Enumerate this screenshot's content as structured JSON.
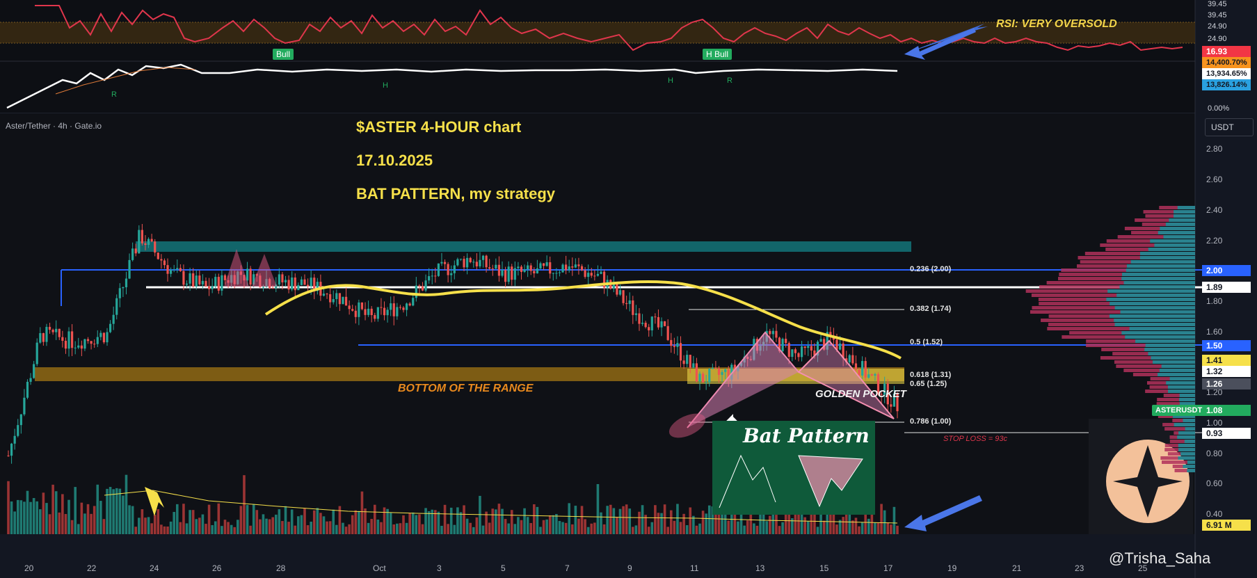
{
  "header": {
    "symbol": "Aster/Tether · 4h · Gate.io",
    "title_lines": [
      "$ASTER   4-HOUR chart",
      "17.10.2025",
      "BAT PATTERN, my strategy"
    ],
    "unit_button": "USDT"
  },
  "annotations": {
    "rsi_note": "RSI: VERY OVERSOLD",
    "bottom_range": "BOTTOM OF THE RANGE",
    "golden_pocket": "GOLDEN POCKET",
    "stop_loss": "STOP LOSS = 93c",
    "bat_pattern": "Bat Pattern",
    "watermark": "@Trisha_Saha",
    "bull_badge_1": "Bull",
    "bull_badge_2": "H Bull",
    "div_r": "R",
    "div_h": "H"
  },
  "fib_levels": [
    {
      "label": "0.236 (2.00)",
      "price": 2.0
    },
    {
      "label": "0.382 (1.74)",
      "price": 1.74
    },
    {
      "label": "0.5 (1.52)",
      "price": 1.52
    },
    {
      "label": "0.618 (1.31)",
      "price": 1.31
    },
    {
      "label": "0.65 (1.25)",
      "price": 1.25
    },
    {
      "label": "0.786 (1.00)",
      "price": 1.0
    }
  ],
  "price_axis": {
    "ticks": [
      "2.80",
      "2.60",
      "2.40",
      "2.20",
      "1.80",
      "1.60",
      "1.20",
      "1.00",
      "0.80",
      "0.60",
      "0.40"
    ],
    "tags": [
      {
        "text": "2.00",
        "bg": "#2962ff",
        "fg": "#ffffff",
        "price": 2.0
      },
      {
        "text": "1.89",
        "bg": "#ffffff",
        "fg": "#131722",
        "price": 1.89
      },
      {
        "text": "1.50",
        "bg": "#2962ff",
        "fg": "#ffffff",
        "price": 1.5
      },
      {
        "text": "1.41",
        "bg": "#f6e04a",
        "fg": "#131722",
        "price": 1.41
      },
      {
        "text": "1.32",
        "bg": "#ffffff",
        "fg": "#131722",
        "price": 1.32
      },
      {
        "text": "1.26",
        "bg": "#4b4f5c",
        "fg": "#ffffff",
        "price": 1.26
      },
      {
        "text": "1.08",
        "bg": "#22ab5e",
        "fg": "#ffffff",
        "price": 1.08
      },
      {
        "text": "0.93",
        "bg": "#ffffff",
        "fg": "#131722",
        "price": 0.93
      },
      {
        "text": "6.91 M",
        "bg": "#f6e04a",
        "fg": "#131722",
        "price": 0.32
      }
    ],
    "symbol_tag": "ASTERUSDT"
  },
  "rsi_axis": {
    "ticks": [
      "39.45",
      "39.45",
      "24.90",
      "24.90"
    ],
    "current_value": "16.93"
  },
  "indicator_axis": {
    "values": [
      "14,400.70%",
      "13,934.65%",
      "13,826.14%",
      "0.00%"
    ]
  },
  "time_axis": {
    "labels": [
      "20",
      "22",
      "24",
      "26",
      "28",
      "Oct",
      "3",
      "5",
      "7",
      "9",
      "11",
      "13",
      "15",
      "17",
      "19",
      "21",
      "23",
      "25"
    ]
  },
  "chart_data": {
    "type": "line",
    "series": [
      {
        "kind": "candlestick-closes",
        "x": [
          "09-20",
          "09-21",
          "09-22",
          "09-23",
          "09-24",
          "09-25",
          "09-26",
          "09-27",
          "09-28",
          "09-29",
          "09-30",
          "10-01",
          "10-02",
          "10-03",
          "10-04",
          "10-05",
          "10-06",
          "10-07",
          "10-08",
          "10-09",
          "10-10",
          "10-11",
          "10-12",
          "10-13",
          "10-14",
          "10-15",
          "10-16",
          "10-17"
        ],
        "values": [
          0.75,
          1.55,
          1.5,
          1.55,
          2.2,
          1.95,
          1.85,
          1.95,
          1.9,
          1.88,
          1.8,
          1.65,
          1.75,
          1.95,
          2.05,
          1.95,
          1.95,
          2.0,
          1.92,
          1.7,
          1.55,
          1.25,
          1.3,
          1.55,
          1.4,
          1.52,
          1.3,
          1.08
        ]
      }
    ],
    "ylim": [
      0.3,
      2.9
    ],
    "price_scale": "right"
  },
  "colors": {
    "bg": "#131722",
    "up": "#26a69a",
    "down": "#ef5350",
    "fib_blue": "#2962ff",
    "ma_yellow": "#f6e04a",
    "bat_pink": "#f48fb1",
    "rsi_red": "#f23645",
    "range_band": "#8a6514",
    "teal_band": "#137a7f"
  }
}
